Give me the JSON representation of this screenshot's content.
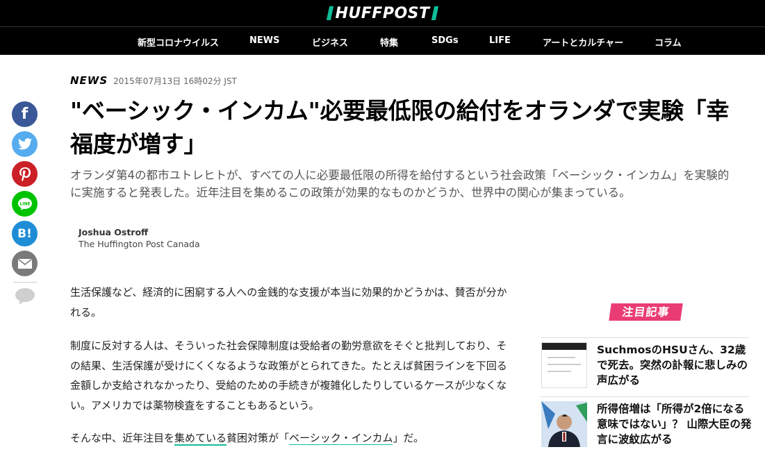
{
  "header": {
    "logo": "HUFFPOST",
    "nav": [
      "新型コロナウイルス",
      "NEWS",
      "ビジネス",
      "特集",
      "SDGs",
      "LIFE",
      "アートとカルチャー",
      "コラム"
    ]
  },
  "article": {
    "section": "NEWS",
    "timestamp": "2015年07月13日 16時02分 JST",
    "headline": "\"ベーシック・インカム\"必要最低限の給付をオランダで実験「幸福度が増す」",
    "dek": "オランダ第4の都市ユトレヒトが、すべての人に必要最低限の所得を給付するという社会政策「ベーシック・インカム」を実験的に実施すると発表した。近年注目を集めるこの政策が効果的なものかどうか、世界中の関心が集まっている。",
    "author": "Joshua Ostroff",
    "outlet": "The Huffington Post Canada",
    "paragraphs": {
      "p1": "生活保護など、経済的に困窮する人への金銭的な支援が本当に効果的かどうかは、賛否が分かれる。",
      "p2": "制度に反対する人は、そういった社会保障制度は受給者の勤労意欲をそぐと批判しており、その結果、生活保護が受けにくくなるような政策がとられてきた。たとえば貧困ラインを下回る金額しか支給されなかったり、受給のための手続きが複雑化したりしているケースが少なくない。アメリカでは薬物検査をすることもあるという。",
      "p3_before": "そんな中、近年注目を",
      "p3_underline": "集めている",
      "p3_middle": "貧困対策が「",
      "p3_link": "ベーシック・インカム",
      "p3_after": "」だ。"
    }
  },
  "share": {
    "facebook": "f",
    "hatena": "B!",
    "line": "LINE",
    "icons": [
      "facebook-icon",
      "twitter-icon",
      "pinterest-icon",
      "line-icon",
      "hatena-bookmark-icon",
      "mail-icon",
      "comment-icon"
    ]
  },
  "sidebar": {
    "title": "注目記事",
    "items": [
      {
        "title": "SuchmosのHSUさん、32歳で死去。突然の訃報に悲しみの声広がる"
      },
      {
        "title": "所得倍増は「所得が2倍になる意味ではない」？ 山際大臣の発言に波紋広がる"
      }
    ]
  },
  "colors": {
    "accent": "#0dbe98",
    "sidebar_badge": "#ea3c74",
    "nav_bg": "#000000"
  }
}
